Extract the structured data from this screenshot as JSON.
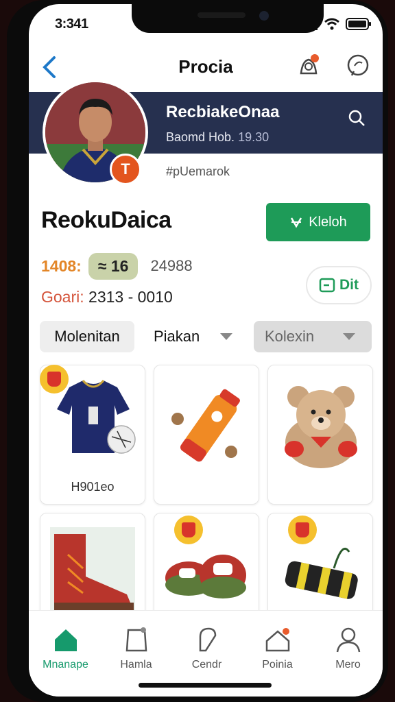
{
  "status": {
    "time": "3:341"
  },
  "header": {
    "title": "Procia"
  },
  "banner": {
    "name": "RecbiakeOnaa",
    "sub_text": "Baomd Hob.",
    "sub_number": "19.30",
    "hashtag": "#pUemarok"
  },
  "profile": {
    "badge_letter": "T"
  },
  "store": {
    "name": "ReokuDaica"
  },
  "follow_button": {
    "label": "Kleloh"
  },
  "stats": {
    "value_a": "1408:",
    "value_b": "16",
    "value_c": "24988"
  },
  "goal": {
    "label": "Goari:",
    "value": "2313 - 0010"
  },
  "edit_button": {
    "label": "Dit"
  },
  "tabs": [
    {
      "label": "Molenitan"
    },
    {
      "label": "Piakan"
    },
    {
      "label": "Kolexin"
    }
  ],
  "products": [
    {
      "label": "H901eo",
      "icon": "jersey"
    },
    {
      "label": "",
      "icon": "bottle"
    },
    {
      "label": "",
      "icon": "teddy-bear"
    },
    {
      "label": "",
      "icon": "boot"
    },
    {
      "label": "",
      "icon": "slippers"
    },
    {
      "label": "",
      "icon": "grip-roller"
    }
  ],
  "nav": [
    {
      "label": "Mnanape",
      "icon": "home-icon",
      "active": true
    },
    {
      "label": "Hamla",
      "icon": "bag-icon"
    },
    {
      "label": "Cendr",
      "icon": "tag-icon"
    },
    {
      "label": "Poinia",
      "icon": "house-outline-icon"
    },
    {
      "label": "Mero",
      "icon": "user-icon"
    }
  ],
  "colors": {
    "accent": "#1e9b58",
    "banner": "#26304f",
    "stat_orange": "#e38628",
    "badge": "#f5c02e"
  }
}
